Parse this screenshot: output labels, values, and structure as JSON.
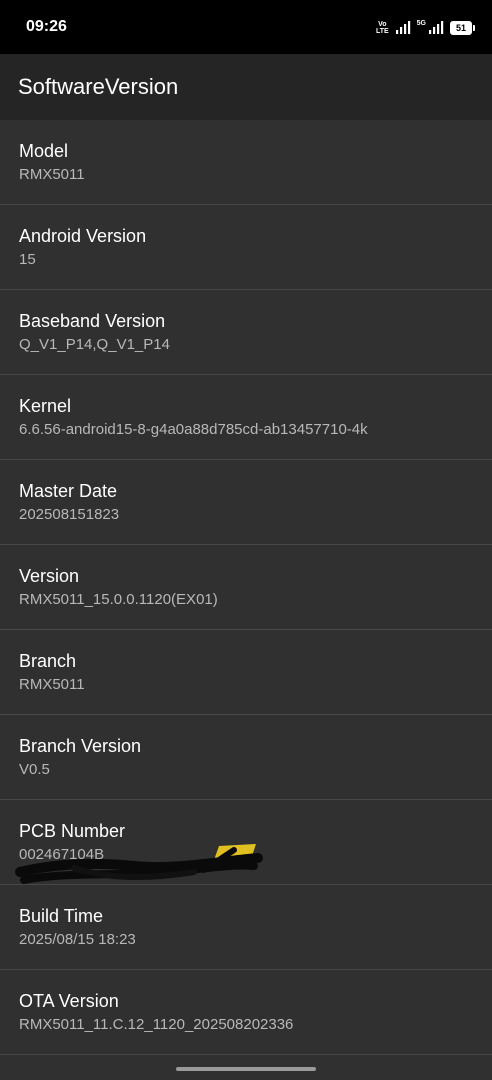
{
  "status_bar": {
    "time": "09:26",
    "volte_top": "Vo",
    "volte_bottom": "LTE",
    "network_label": "5G",
    "battery": "51"
  },
  "app_bar": {
    "title": "SoftwareVersion"
  },
  "items": [
    {
      "label": "Model",
      "value": "RMX5011"
    },
    {
      "label": "Android Version",
      "value": "15"
    },
    {
      "label": "Baseband Version",
      "value": "Q_V1_P14,Q_V1_P14"
    },
    {
      "label": "Kernel",
      "value": "6.6.56-android15-8-g4a0a88d785cd-ab13457710-4k"
    },
    {
      "label": "Master Date",
      "value": "202508151823"
    },
    {
      "label": "Version",
      "value": "RMX5011_15.0.0.1120(EX01)"
    },
    {
      "label": "Branch",
      "value": "RMX5011"
    },
    {
      "label": "Branch Version",
      "value": "V0.5"
    },
    {
      "label": "PCB Number",
      "value": "002467104B"
    },
    {
      "label": "Build Time",
      "value": "2025/08/15 18:23"
    },
    {
      "label": "OTA Version",
      "value": "RMX5011_11.C.12_1120_202508202336"
    }
  ],
  "colors": {
    "background": "#303030",
    "app_bar": "#252525",
    "status_bar": "#000000",
    "divider": "#474747",
    "value_text": "#b8b8b8",
    "redaction_yellow": "#e0c020"
  }
}
